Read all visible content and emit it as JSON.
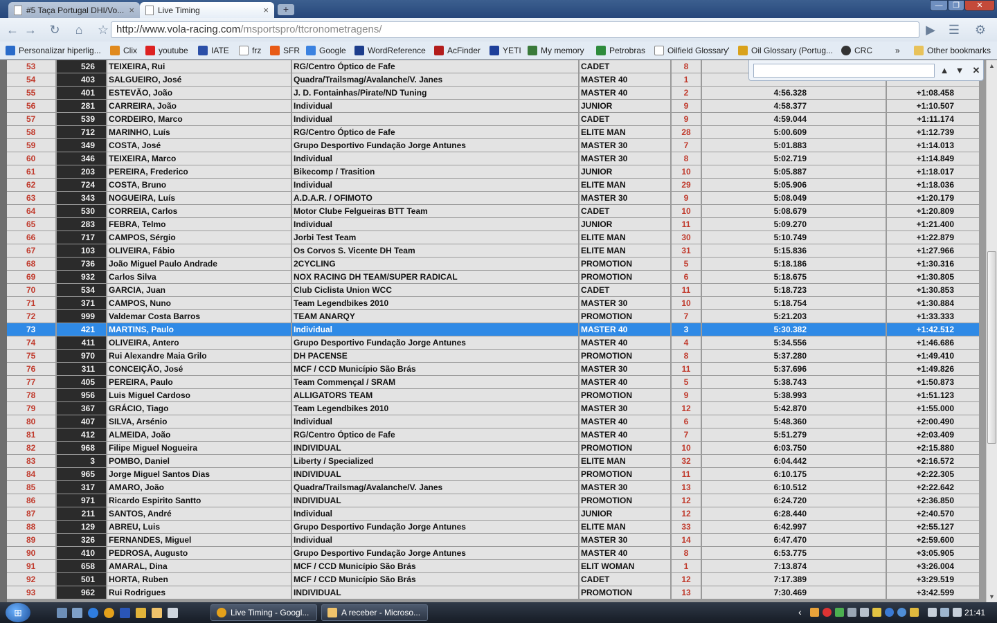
{
  "browser": {
    "tabs": [
      {
        "label": "#5 Taça Portugal DHI/Vo...",
        "active": false
      },
      {
        "label": "Live Timing",
        "active": true
      }
    ],
    "tab_close": "×",
    "new_tab": "+",
    "url_host": "http://www.vola-racing.com",
    "url_path": "/msportspro/ttcronometragens/",
    "bookmarks": [
      {
        "label": "Personalizar hiperlig...",
        "color": "#2a6bc9"
      },
      {
        "label": "Clix",
        "color": "#e08a1e"
      },
      {
        "label": "youtube",
        "color": "#d22"
      },
      {
        "label": "IATE",
        "color": "#2b4fa8"
      },
      {
        "label": "frz",
        "color": "#ffffff"
      },
      {
        "label": "SFR",
        "color": "#e85b17"
      },
      {
        "label": "Google",
        "color": "#3b82e0"
      },
      {
        "label": "WordReference",
        "color": "#1c3d8c"
      },
      {
        "label": "AcFinder",
        "color": "#b31d1d"
      },
      {
        "label": "YETI",
        "color": "#1e3f9a"
      },
      {
        "label": "My memory",
        "color": "#3a7a3a"
      },
      {
        "label": "Petrobras",
        "color": "#2e8b3c"
      },
      {
        "label": "Oilfield Glossary'",
        "color": "#ffffff"
      },
      {
        "label": "Oil Glossary (Portug...",
        "color": "#d9a21c"
      },
      {
        "label": "CRC",
        "color": "#333333"
      }
    ],
    "bookmarks_more": "»",
    "other_bookmarks": "Other bookmarks"
  },
  "find": {
    "value": "",
    "prev": "▲",
    "next": "▼",
    "close": "✕"
  },
  "table": {
    "highlight_pos": "73",
    "rows": [
      {
        "pos": "53",
        "num": "526",
        "name": "TEIXEIRA, Rui",
        "team": "RG/Centro Óptico de Fafe",
        "cat": "CADET",
        "pc": "8",
        "time": "",
        "gap": ""
      },
      {
        "pos": "54",
        "num": "403",
        "name": "SALGUEIRO, José",
        "team": "Quadra/Trailsmag/Avalanche/V. Janes",
        "cat": "MASTER 40",
        "pc": "1",
        "time": "",
        "gap": ""
      },
      {
        "pos": "55",
        "num": "401",
        "name": "ESTEVÃO, João",
        "team": "J. D. Fontainhas/Pirate/ND Tuning",
        "cat": "MASTER 40",
        "pc": "2",
        "time": "4:56.328",
        "gap": "+1:08.458"
      },
      {
        "pos": "56",
        "num": "281",
        "name": "CARREIRA, João",
        "team": "Individual",
        "cat": "JUNIOR",
        "pc": "9",
        "time": "4:58.377",
        "gap": "+1:10.507"
      },
      {
        "pos": "57",
        "num": "539",
        "name": "CORDEIRO, Marco",
        "team": "Individual",
        "cat": "CADET",
        "pc": "9",
        "time": "4:59.044",
        "gap": "+1:11.174"
      },
      {
        "pos": "58",
        "num": "712",
        "name": "MARINHO, Luís",
        "team": "RG/Centro Óptico de Fafe",
        "cat": "ELITE MAN",
        "pc": "28",
        "time": "5:00.609",
        "gap": "+1:12.739"
      },
      {
        "pos": "59",
        "num": "349",
        "name": "COSTA, José",
        "team": "Grupo Desportivo Fundação Jorge Antunes",
        "cat": "MASTER 30",
        "pc": "7",
        "time": "5:01.883",
        "gap": "+1:14.013"
      },
      {
        "pos": "60",
        "num": "346",
        "name": "TEIXEIRA, Marco",
        "team": "Individual",
        "cat": "MASTER 30",
        "pc": "8",
        "time": "5:02.719",
        "gap": "+1:14.849"
      },
      {
        "pos": "61",
        "num": "203",
        "name": "PEREIRA, Frederico",
        "team": "Bikecomp / Trasition",
        "cat": "JUNIOR",
        "pc": "10",
        "time": "5:05.887",
        "gap": "+1:18.017"
      },
      {
        "pos": "62",
        "num": "724",
        "name": "COSTA, Bruno",
        "team": "Individual",
        "cat": "ELITE MAN",
        "pc": "29",
        "time": "5:05.906",
        "gap": "+1:18.036"
      },
      {
        "pos": "63",
        "num": "343",
        "name": "NOGUEIRA, Luís",
        "team": "A.D.A.R. / OFIMOTO",
        "cat": "MASTER 30",
        "pc": "9",
        "time": "5:08.049",
        "gap": "+1:20.179"
      },
      {
        "pos": "64",
        "num": "530",
        "name": "CORREIA, Carlos",
        "team": "Motor Clube Felgueiras BTT Team",
        "cat": "CADET",
        "pc": "10",
        "time": "5:08.679",
        "gap": "+1:20.809"
      },
      {
        "pos": "65",
        "num": "283",
        "name": "FEBRA, Telmo",
        "team": "Individual",
        "cat": "JUNIOR",
        "pc": "11",
        "time": "5:09.270",
        "gap": "+1:21.400"
      },
      {
        "pos": "66",
        "num": "717",
        "name": "CAMPOS, Sérgio",
        "team": "Jorbi Test Team",
        "cat": "ELITE MAN",
        "pc": "30",
        "time": "5:10.749",
        "gap": "+1:22.879"
      },
      {
        "pos": "67",
        "num": "103",
        "name": "OLIVEIRA, Fábio",
        "team": "Os Corvos S. Vicente DH Team",
        "cat": "ELITE MAN",
        "pc": "31",
        "time": "5:15.836",
        "gap": "+1:27.966"
      },
      {
        "pos": "68",
        "num": "736",
        "name": "João Miguel Paulo Andrade",
        "team": "2CYCLING",
        "cat": "PROMOTION",
        "pc": "5",
        "time": "5:18.186",
        "gap": "+1:30.316"
      },
      {
        "pos": "69",
        "num": "932",
        "name": "Carlos Silva",
        "team": "NOX RACING DH TEAM/SUPER RADICAL",
        "cat": "PROMOTION",
        "pc": "6",
        "time": "5:18.675",
        "gap": "+1:30.805"
      },
      {
        "pos": "70",
        "num": "534",
        "name": "GARCIA, Juan",
        "team": "Club Ciclista Union WCC",
        "cat": "CADET",
        "pc": "11",
        "time": "5:18.723",
        "gap": "+1:30.853"
      },
      {
        "pos": "71",
        "num": "371",
        "name": "CAMPOS, Nuno",
        "team": "Team Legendbikes 2010",
        "cat": "MASTER 30",
        "pc": "10",
        "time": "5:18.754",
        "gap": "+1:30.884"
      },
      {
        "pos": "72",
        "num": "999",
        "name": "Valdemar Costa Barros",
        "team": "TEAM ANARQY",
        "cat": "PROMOTION",
        "pc": "7",
        "time": "5:21.203",
        "gap": "+1:33.333"
      },
      {
        "pos": "73",
        "num": "421",
        "name": "MARTINS, Paulo",
        "team": "Individual",
        "cat": "MASTER 40",
        "pc": "3",
        "time": "5:30.382",
        "gap": "+1:42.512"
      },
      {
        "pos": "74",
        "num": "411",
        "name": "OLIVEIRA, Antero",
        "team": "Grupo Desportivo Fundação Jorge Antunes",
        "cat": "MASTER 40",
        "pc": "4",
        "time": "5:34.556",
        "gap": "+1:46.686"
      },
      {
        "pos": "75",
        "num": "970",
        "name": "Rui Alexandre Maia Grilo",
        "team": "DH PACENSE",
        "cat": "PROMOTION",
        "pc": "8",
        "time": "5:37.280",
        "gap": "+1:49.410"
      },
      {
        "pos": "76",
        "num": "311",
        "name": "CONCEIÇÃO, José",
        "team": "MCF / CCD Município São Brás",
        "cat": "MASTER 30",
        "pc": "11",
        "time": "5:37.696",
        "gap": "+1:49.826"
      },
      {
        "pos": "77",
        "num": "405",
        "name": "PEREIRA, Paulo",
        "team": "Team Commençal / SRAM",
        "cat": "MASTER 40",
        "pc": "5",
        "time": "5:38.743",
        "gap": "+1:50.873"
      },
      {
        "pos": "78",
        "num": "956",
        "name": "Luis Miguel Cardoso",
        "team": "ALLIGATORS TEAM",
        "cat": "PROMOTION",
        "pc": "9",
        "time": "5:38.993",
        "gap": "+1:51.123"
      },
      {
        "pos": "79",
        "num": "367",
        "name": "GRÁCIO, Tiago",
        "team": "Team Legendbikes 2010",
        "cat": "MASTER 30",
        "pc": "12",
        "time": "5:42.870",
        "gap": "+1:55.000"
      },
      {
        "pos": "80",
        "num": "407",
        "name": "SILVA, Arsénio",
        "team": "Individual",
        "cat": "MASTER 40",
        "pc": "6",
        "time": "5:48.360",
        "gap": "+2:00.490"
      },
      {
        "pos": "81",
        "num": "412",
        "name": "ALMEIDA, João",
        "team": "RG/Centro Óptico de Fafe",
        "cat": "MASTER 40",
        "pc": "7",
        "time": "5:51.279",
        "gap": "+2:03.409"
      },
      {
        "pos": "82",
        "num": "968",
        "name": "Filipe Miguel Nogueira",
        "team": "INDIVIDUAL",
        "cat": "PROMOTION",
        "pc": "10",
        "time": "6:03.750",
        "gap": "+2:15.880"
      },
      {
        "pos": "83",
        "num": "3",
        "name": "POMBO, Daniel",
        "team": "Liberty / Specialized",
        "cat": "ELITE MAN",
        "pc": "32",
        "time": "6:04.442",
        "gap": "+2:16.572"
      },
      {
        "pos": "84",
        "num": "965",
        "name": "Jorge Miguel Santos Dias",
        "team": "INDIVIDUAL",
        "cat": "PROMOTION",
        "pc": "11",
        "time": "6:10.175",
        "gap": "+2:22.305"
      },
      {
        "pos": "85",
        "num": "317",
        "name": "AMARO, João",
        "team": "Quadra/Trailsmag/Avalanche/V. Janes",
        "cat": "MASTER 30",
        "pc": "13",
        "time": "6:10.512",
        "gap": "+2:22.642"
      },
      {
        "pos": "86",
        "num": "971",
        "name": "Ricardo Espirito Santto",
        "team": "INDIVIDUAL",
        "cat": "PROMOTION",
        "pc": "12",
        "time": "6:24.720",
        "gap": "+2:36.850"
      },
      {
        "pos": "87",
        "num": "211",
        "name": "SANTOS, André",
        "team": "Individual",
        "cat": "JUNIOR",
        "pc": "12",
        "time": "6:28.440",
        "gap": "+2:40.570"
      },
      {
        "pos": "88",
        "num": "129",
        "name": "ABREU, Luis",
        "team": "Grupo Desportivo Fundação Jorge Antunes",
        "cat": "ELITE MAN",
        "pc": "33",
        "time": "6:42.997",
        "gap": "+2:55.127"
      },
      {
        "pos": "89",
        "num": "326",
        "name": "FERNANDES, Miguel",
        "team": "Individual",
        "cat": "MASTER 30",
        "pc": "14",
        "time": "6:47.470",
        "gap": "+2:59.600"
      },
      {
        "pos": "90",
        "num": "410",
        "name": "PEDROSA, Augusto",
        "team": "Grupo Desportivo Fundação Jorge Antunes",
        "cat": "MASTER 40",
        "pc": "8",
        "time": "6:53.775",
        "gap": "+3:05.905"
      },
      {
        "pos": "91",
        "num": "658",
        "name": "AMARAL, Dina",
        "team": "MCF / CCD Município São Brás",
        "cat": "ELIT WOMAN",
        "pc": "1",
        "time": "7:13.874",
        "gap": "+3:26.004"
      },
      {
        "pos": "92",
        "num": "501",
        "name": "HORTA, Ruben",
        "team": "MCF / CCD Município São Brás",
        "cat": "CADET",
        "pc": "12",
        "time": "7:17.389",
        "gap": "+3:29.519"
      },
      {
        "pos": "93",
        "num": "962",
        "name": "Rui Rodrigues",
        "team": "INDIVIDUAL",
        "cat": "PROMOTION",
        "pc": "13",
        "time": "7:30.469",
        "gap": "+3:42.599"
      }
    ]
  },
  "scroll": {
    "thumb_position": 0.55,
    "thumb_fraction": 0.37
  },
  "taskbar": {
    "start": "⊞",
    "tasks": [
      {
        "label": "Live Timing - Googl...",
        "color": "#e4a11b"
      },
      {
        "label": "A receber - Microso...",
        "color": "#f0c36b"
      }
    ],
    "tray_arrow": "‹",
    "clock": "21:41"
  }
}
